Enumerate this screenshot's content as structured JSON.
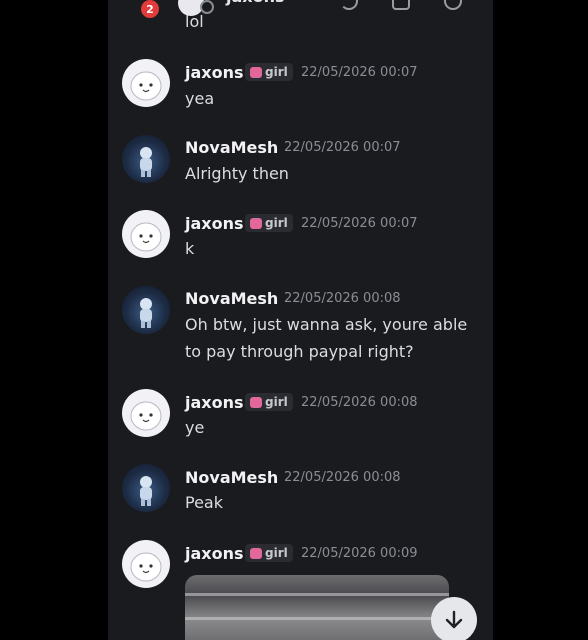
{
  "header": {
    "badge_count": "2",
    "channel_name": "jaxons",
    "cutoff_text": "lol"
  },
  "users": {
    "jaxons": {
      "name": "jaxons",
      "tag": "girl"
    },
    "nova": {
      "name": "NovaMesh"
    }
  },
  "messages": [
    {
      "author": "jaxons",
      "time": "22/05/2026 00:07",
      "text": "yea"
    },
    {
      "author": "NovaMesh",
      "time": "22/05/2026 00:07",
      "text": "Alrighty then"
    },
    {
      "author": "jaxons",
      "time": "22/05/2026 00:07",
      "text": "k"
    },
    {
      "author": "NovaMesh",
      "time": "22/05/2026 00:08",
      "line1": "Oh btw, just wanna ask, youre able",
      "line2": "to pay through paypal right?"
    },
    {
      "author": "jaxons",
      "time": "22/05/2026 00:08",
      "text": "ye"
    },
    {
      "author": "NovaMesh",
      "time": "22/05/2026 00:08",
      "text": "Peak"
    },
    {
      "author": "jaxons",
      "time": "22/05/2026 00:09",
      "text": ""
    }
  ],
  "icons": {
    "scroll_down": "arrow-down-icon",
    "tag": "crown-icon"
  },
  "colors": {
    "background": "#1a1b1f",
    "badge": "#e23b3b",
    "tag_icon": "#e2679b"
  }
}
